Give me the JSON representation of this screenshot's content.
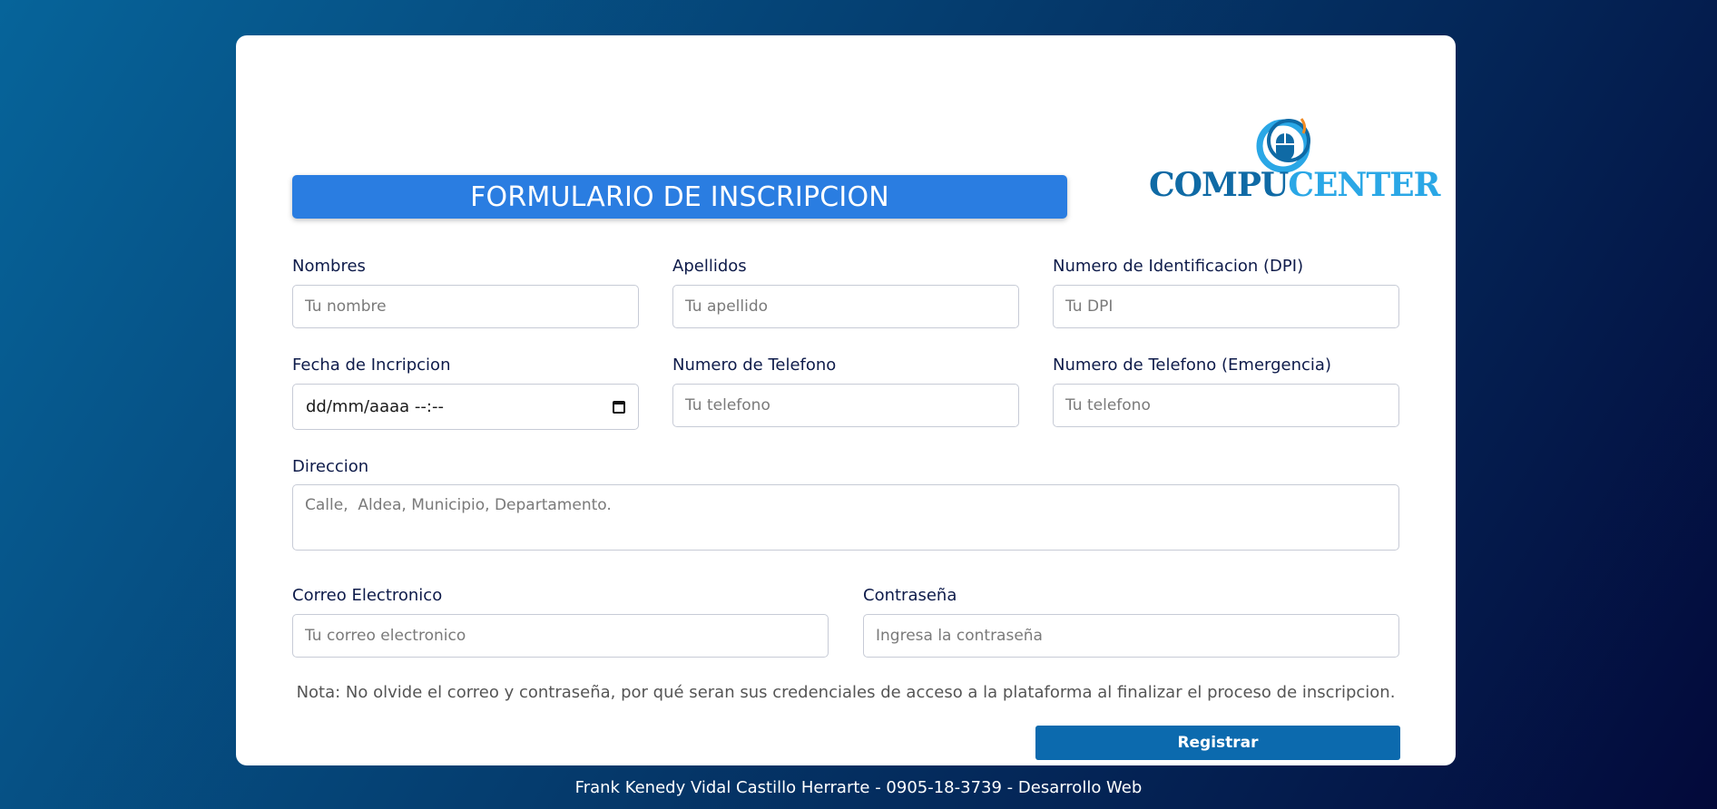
{
  "brand": {
    "logo_part1": "COMPU",
    "logo_part2": "CENTER",
    "icon": "mouse-icon",
    "colors": {
      "dark": "#0f6aa5",
      "light": "#2aa7e6"
    }
  },
  "form": {
    "title": "FORMULARIO DE INSCRIPCION",
    "fields": {
      "nombres": {
        "label": "Nombres",
        "placeholder": "Tu nombre"
      },
      "apellidos": {
        "label": "Apellidos",
        "placeholder": "Tu apellido"
      },
      "dpi": {
        "label": "Numero de Identificacion (DPI)",
        "placeholder": "Tu DPI"
      },
      "fecha": {
        "label": "Fecha de Incripcion",
        "value": "dd/mm/aaaa --:--"
      },
      "telefono": {
        "label": "Numero de Telefono",
        "placeholder": "Tu telefono"
      },
      "telefono_emergencia": {
        "label": "Numero de Telefono (Emergencia)",
        "placeholder": "Tu telefono"
      },
      "direccion": {
        "label": "Direccion",
        "placeholder": "Calle,  Aldea, Municipio, Departamento."
      },
      "correo": {
        "label": "Correo Electronico",
        "placeholder": "Tu correo electronico"
      },
      "contrasena": {
        "label": "Contraseña",
        "placeholder": "Ingresa la contraseña"
      }
    },
    "note": "Nota: No olvide el correo y contraseña, por qué seran sus credenciales de acceso a la plataforma al finalizar el proceso de inscripcion.",
    "submit_label": "Registrar"
  },
  "footer": {
    "text": "Frank Kenedy Vidal Castillo Herrarte - 0905-18-3739 - Desarrollo Web"
  },
  "colors": {
    "banner": "#2a7de1",
    "button": "#0c6aae",
    "background_start": "#06649a",
    "background_end": "#03093a"
  }
}
